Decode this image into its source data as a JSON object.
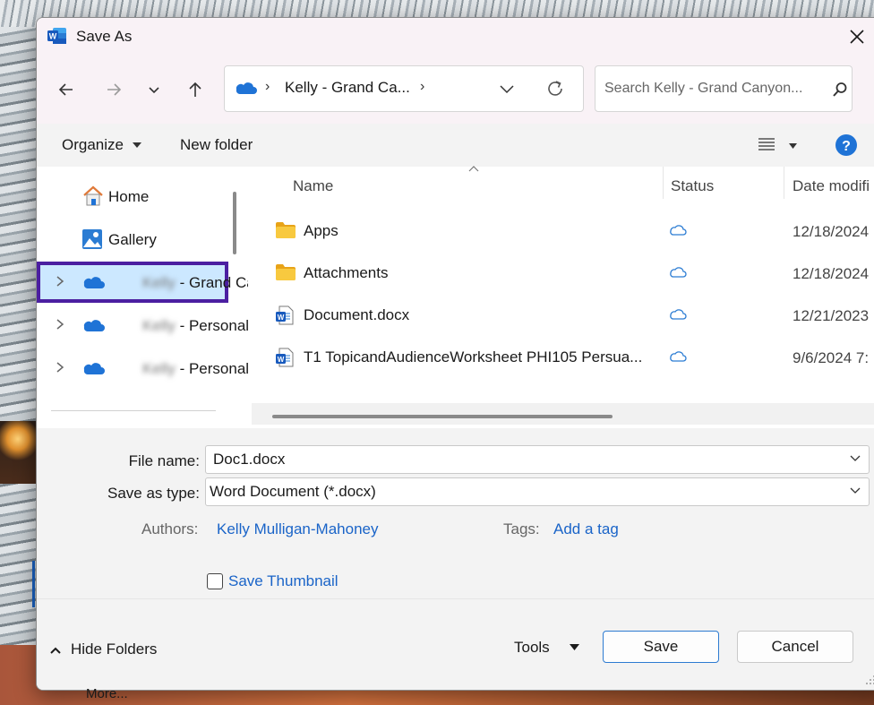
{
  "window": {
    "title": "Save As"
  },
  "address_bar": {
    "path": "Kelly - Grand Ca..."
  },
  "search": {
    "placeholder": "Search Kelly - Grand Canyon..."
  },
  "toolbar": {
    "organize": "Organize",
    "new_folder": "New folder"
  },
  "nav_pane": {
    "items": [
      {
        "label": "Home",
        "icon": "home-icon"
      },
      {
        "label": "Gallery",
        "icon": "gallery-icon"
      },
      {
        "label_blurred": "Kelly",
        "label": " - Grand Ca",
        "icon": "onedrive-icon",
        "selected": true
      },
      {
        "label_blurred": "Kelly",
        "label": " - Personal",
        "icon": "onedrive-icon"
      },
      {
        "label_blurred": "Kelly",
        "label": " - Personal",
        "icon": "onedrive-icon"
      }
    ],
    "more": "More..."
  },
  "file_list": {
    "columns": [
      "Name",
      "Status",
      "Date modifi"
    ],
    "rows": [
      {
        "name": "Apps",
        "type": "folder",
        "status": "cloud-icon",
        "date": "12/18/2024"
      },
      {
        "name": "Attachments",
        "type": "folder",
        "status": "cloud-icon",
        "date": "12/18/2024"
      },
      {
        "name": "Document.docx",
        "type": "word",
        "status": "cloud-icon",
        "date": "12/21/2023"
      },
      {
        "name": "T1 TopicandAudienceWorksheet PHI105 Persua...",
        "type": "word",
        "status": "cloud-icon",
        "date": "9/6/2024 7:"
      }
    ]
  },
  "form": {
    "file_name_label": "File name:",
    "file_name_value": "Doc1.docx",
    "save_type_label": "Save as type:",
    "save_type_value": "Word Document (*.docx)",
    "authors_label": "Authors:",
    "authors_value": "Kelly Mulligan-Mahoney",
    "tags_label": "Tags:",
    "tags_value": "Add a tag",
    "thumbnail_label": "Save Thumbnail"
  },
  "footer": {
    "hide_folders": "Hide Folders",
    "tools": "Tools",
    "save": "Save",
    "cancel": "Cancel"
  },
  "colors": {
    "accent": "#1a64c8",
    "selection": "#cce8ff",
    "highlight_border": "#4b1fa1",
    "folder": "#f8c93f",
    "onedrive": "#1f73d6"
  }
}
